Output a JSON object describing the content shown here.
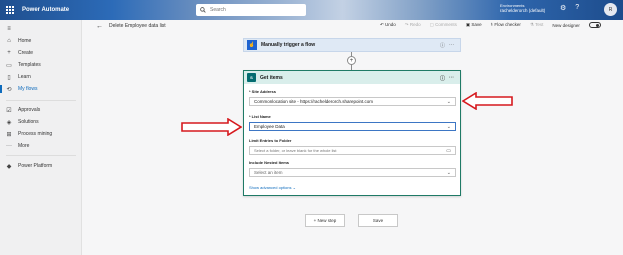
{
  "topbar": {
    "app_name": "Power Automate",
    "search_placeholder": "Search",
    "environment_label": "Environments",
    "environment_name": "rachelderorch (default)",
    "avatar_initials": "R"
  },
  "sidebar": {
    "items": [
      {
        "label": "Home",
        "icon": "home-icon"
      },
      {
        "label": "Create",
        "icon": "plus-icon"
      },
      {
        "label": "Templates",
        "icon": "templates-icon"
      },
      {
        "label": "Learn",
        "icon": "book-icon"
      },
      {
        "label": "My flows",
        "icon": "flows-icon"
      },
      {
        "label": "Approvals",
        "icon": "approvals-icon"
      },
      {
        "label": "Solutions",
        "icon": "solutions-icon"
      },
      {
        "label": "Process mining",
        "icon": "process-mining-icon"
      },
      {
        "label": "More",
        "icon": "more-icon"
      },
      {
        "label": "Power Platform",
        "icon": "power-platform-icon"
      }
    ]
  },
  "command_bar": {
    "flow_title": "Delete Employee data list",
    "undo": "Undo",
    "redo": "Redo",
    "comments": "Comments",
    "save": "Save",
    "flow_checker": "Flow checker",
    "test": "Test",
    "new_designer": "New designer"
  },
  "trigger": {
    "title": "Manually trigger a flow"
  },
  "action": {
    "title": "Get items",
    "site_address_label": "* Site Address",
    "site_address_value": "Commonlocation site - https://rachelderorch.sharepoint.com",
    "list_name_label": "* List Name",
    "list_name_value": "Employee Data",
    "limit_label": "Limit Entries to Folder",
    "limit_placeholder": "Select a folder, or leave blank for the whole list",
    "nested_label": "Include Nested Items",
    "nested_placeholder": "Select an item",
    "advanced": "Show advanced options"
  },
  "footer": {
    "new_step": "+ New step",
    "save": "Save"
  },
  "colors": {
    "accent": "#0f6cbd",
    "sharepoint": "#036c70",
    "arrow": "#d6191e"
  }
}
